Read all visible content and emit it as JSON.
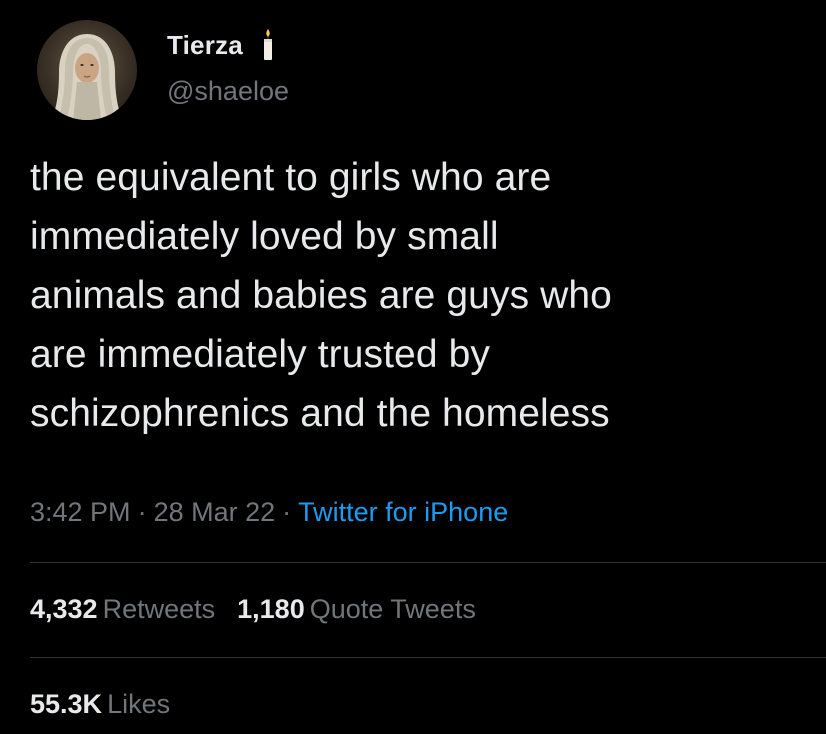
{
  "user": {
    "display_name": "Tierza",
    "handle": "@shaeloe",
    "badge_icon": "candle-icon"
  },
  "tweet": {
    "text": "the equivalent to girls who are\nimmediately loved by small\nanimals and babies are guys who\nare immediately trusted by\nschizophrenics and the homeless",
    "time": "3:42 PM",
    "separator": "·",
    "date": "28 Mar 22",
    "source": "Twitter for iPhone"
  },
  "stats": {
    "retweets_count": "4,332",
    "retweets_label": "Retweets",
    "quotes_count": "1,180",
    "quotes_label": "Quote Tweets",
    "likes_count": "55.3K",
    "likes_label": "Likes"
  },
  "colors": {
    "background": "#000000",
    "text": "#e7e9ea",
    "muted": "#71767b",
    "link": "#1d9bf0",
    "divider": "#2f3336"
  }
}
